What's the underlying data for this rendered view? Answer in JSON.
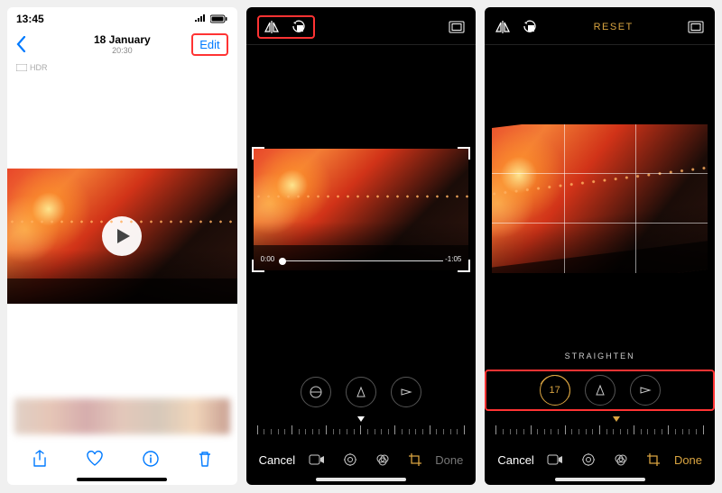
{
  "status": {
    "time": "13:45"
  },
  "p1": {
    "date": "18 January",
    "time": "20:30",
    "edit": "Edit",
    "hdr": "HDR"
  },
  "p2": {
    "trim_start": "0:00",
    "trim_end": "-1:05",
    "cancel": "Cancel",
    "done": "Done"
  },
  "p3": {
    "reset": "RESET",
    "adjust_label": "STRAIGHTEN",
    "straighten_value": "17",
    "cancel": "Cancel",
    "done": "Done"
  },
  "icons": {
    "flip": "flip-horizontal-icon",
    "rotate": "rotate-icon",
    "aspect": "aspect-ratio-icon"
  }
}
